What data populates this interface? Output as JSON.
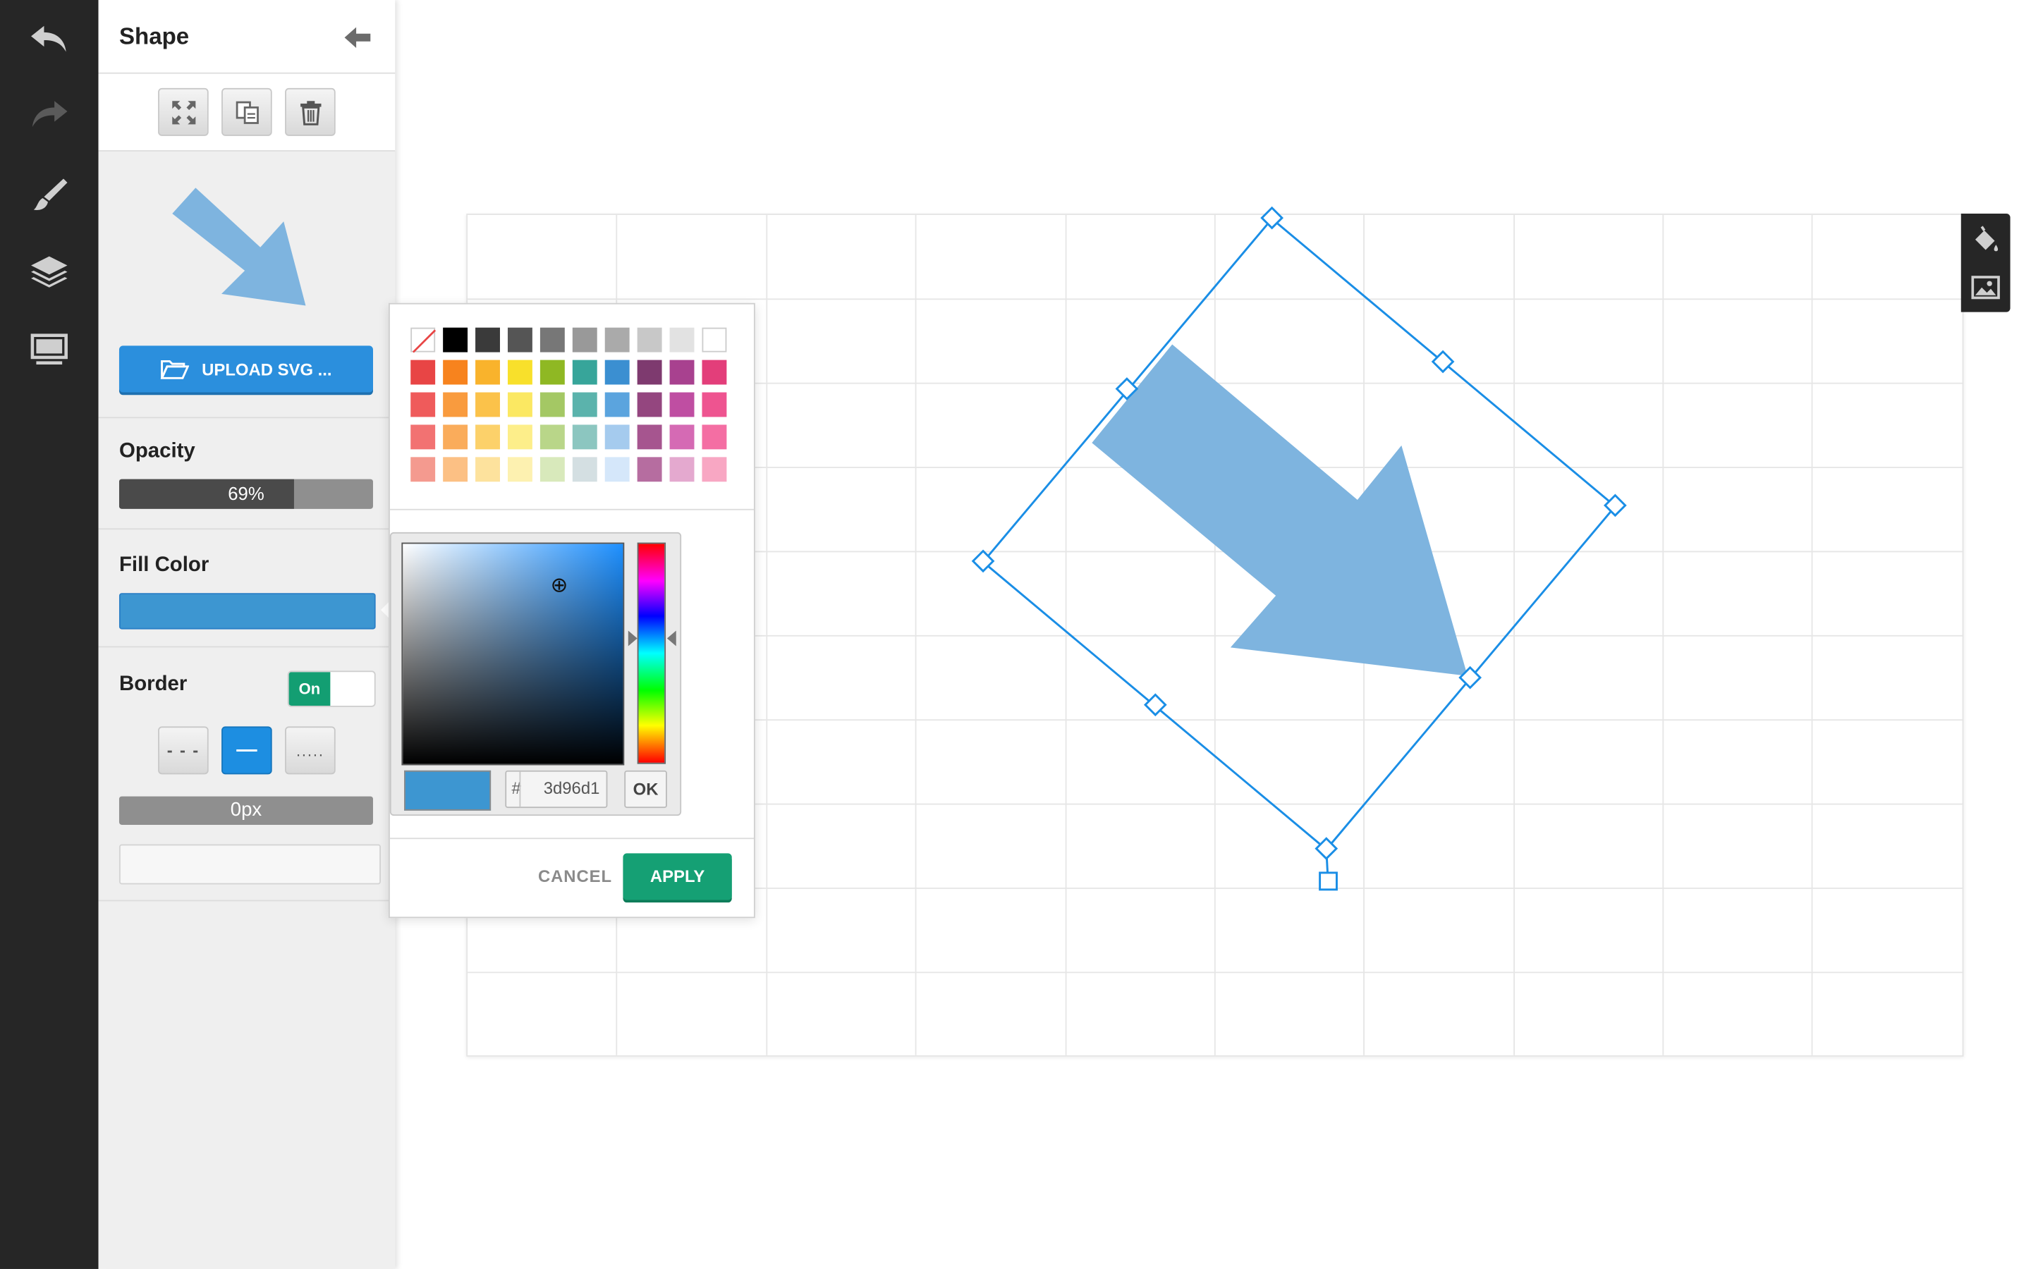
{
  "panel": {
    "title": "Shape",
    "upload_label": "UPLOAD SVG ...",
    "opacity_label": "Opacity",
    "opacity_text": "69%",
    "opacity_value": 0.69,
    "fill_label": "Fill Color",
    "fill_color": "#3d96d1",
    "border_label": "Border",
    "border_toggle": "On",
    "border_styles": [
      "- - -",
      "—",
      "....."
    ],
    "border_width": "0px",
    "border_input_value": ""
  },
  "toolbar": {
    "icons": [
      "undo-icon",
      "redo-icon",
      "brush-icon",
      "layers-icon",
      "monitor-icon"
    ]
  },
  "actions": {
    "icons": [
      "fullscreen-icon",
      "duplicate-icon",
      "trash-icon"
    ]
  },
  "side_tools": {
    "icons": [
      "paint-bucket-icon",
      "image-icon"
    ]
  },
  "picker": {
    "swatches": [
      [
        "none",
        "#000000",
        "#3a3a3a",
        "#555555",
        "#777777",
        "#999999",
        "#aaaaaa",
        "#c8c8c8",
        "#e2e2e2",
        "#ffffff"
      ],
      [
        "#e84545",
        "#f7831e",
        "#f9b32c",
        "#f8e02b",
        "#8fb823",
        "#37a59a",
        "#3b8fd1",
        "#7e3a6f",
        "#a8418f",
        "#e33e7a"
      ],
      [
        "#ef5b5b",
        "#f99b3e",
        "#fbc24a",
        "#fbe862",
        "#a4c864",
        "#5bb3ac",
        "#5ba4de",
        "#94467f",
        "#bf4ea2",
        "#ee5490"
      ],
      [
        "#f27272",
        "#faac5b",
        "#fcd16a",
        "#fdee8a",
        "#b9d689",
        "#8cc6c0",
        "#a5cbee",
        "#a6558f",
        "#d56ab4",
        "#f46ea3"
      ],
      [
        "#f49a8f",
        "#fcc084",
        "#fde29d",
        "#fdf1b0",
        "#d8e9bb",
        "#d4dfe2",
        "#d5e7fa",
        "#b66da0",
        "#e4a9cf",
        "#f8a7c3"
      ]
    ],
    "hex_prefix": "#",
    "hex_value": "3d96d1",
    "ok_label": "OK",
    "cancel_label": "CANCEL",
    "apply_label": "APPLY",
    "current_color": "#3d96d1",
    "hue_color": "#1e90ff"
  },
  "colors": {
    "accent_blue": "#2b8fdd",
    "arrow_color": "#7eb4df",
    "selection_color": "#1a8ee6",
    "success_green": "#15a074",
    "toolbar_bg": "#262626"
  }
}
